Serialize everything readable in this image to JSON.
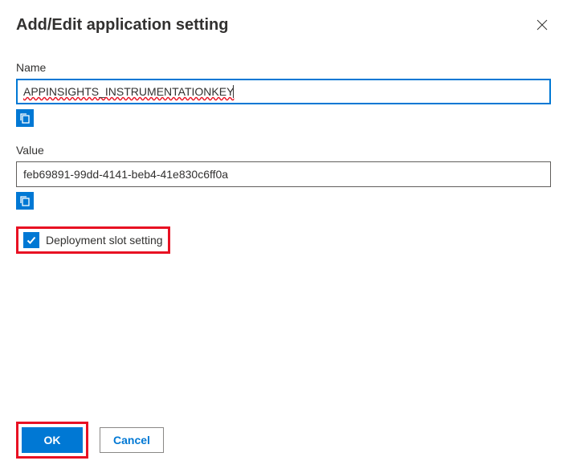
{
  "dialog": {
    "title": "Add/Edit application setting"
  },
  "fields": {
    "name": {
      "label": "Name",
      "value": "APPINSIGHTS_INSTRUMENTATIONKEY"
    },
    "value": {
      "label": "Value",
      "value": "feb69891-99dd-4141-beb4-41e830c6ff0a"
    }
  },
  "checkbox": {
    "label": "Deployment slot setting",
    "checked": true
  },
  "buttons": {
    "ok": "OK",
    "cancel": "Cancel"
  }
}
